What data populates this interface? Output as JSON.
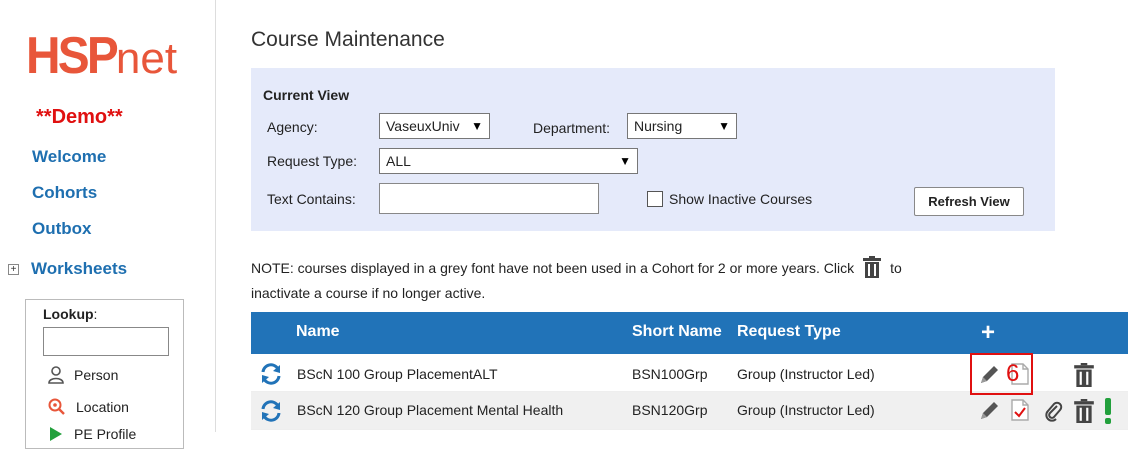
{
  "sidebar": {
    "logo": {
      "hsp": "HSP",
      "net": "net"
    },
    "demo_label": "**Demo**",
    "nav": [
      {
        "label": "Welcome"
      },
      {
        "label": "Cohorts"
      },
      {
        "label": "Outbox"
      },
      {
        "label": "Worksheets",
        "expander": "+"
      }
    ],
    "lookup": {
      "label": "Lookup",
      "colon": ":",
      "items": [
        {
          "label": "Person",
          "icon": "person-icon"
        },
        {
          "label": "Location",
          "icon": "location-search-icon"
        },
        {
          "label": "PE Profile",
          "icon": "play-icon"
        }
      ]
    }
  },
  "main": {
    "title": "Course Maintenance",
    "current_view": {
      "heading": "Current View",
      "agency_label": "Agency:",
      "agency_value": "VaseuxUniv",
      "department_label": "Department:",
      "department_value": "Nursing",
      "request_type_label": "Request Type:",
      "request_type_value": "ALL",
      "text_contains_label": "Text Contains:",
      "text_contains_value": "",
      "show_inactive_label": "Show Inactive Courses",
      "show_inactive_checked": false,
      "refresh_label": "Refresh View"
    },
    "note_part1": "NOTE: courses displayed in a grey font have not been used in a Cohort for 2 or more years. Click",
    "note_part2": "to inactivate a course if no longer active.",
    "table": {
      "columns": [
        "Name",
        "Short Name",
        "Request Type",
        "+"
      ],
      "rows": [
        {
          "name": "BScN 100 Group PlacementALT",
          "short": "BSN100Grp",
          "type": "Group (Instructor Led)"
        },
        {
          "name": "BScN 120 Group Placement Mental Health",
          "short": "BSN120Grp",
          "type": "Group (Instructor Led)"
        }
      ]
    },
    "annotation_number": "6"
  },
  "colors": {
    "brand": "#e8563a",
    "link": "#1e6fb0",
    "header": "#2173b8",
    "panel": "#e5eafa",
    "alert": "#e01010",
    "green": "#22a03c"
  }
}
